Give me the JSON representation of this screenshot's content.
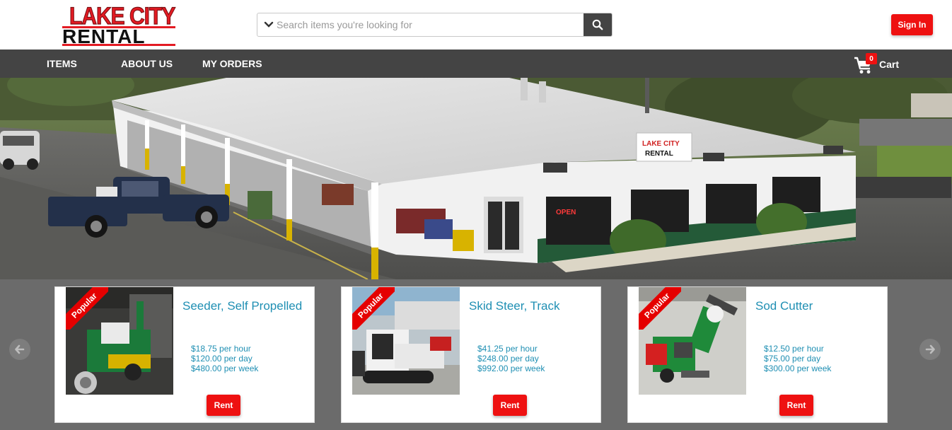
{
  "header": {
    "logo_line1": "LAKE CITY",
    "logo_line2": "RENTAL",
    "search_placeholder": "Search items you're looking for",
    "search_value": "",
    "signin_label": "Sign In"
  },
  "nav": {
    "items": [
      {
        "label": "ITEMS"
      },
      {
        "label": "ABOUT US"
      },
      {
        "label": "MY ORDERS"
      }
    ],
    "cart": {
      "label": "Cart",
      "count": "0"
    }
  },
  "hero": {
    "sign_line1": "LAKE CITY",
    "sign_line2": "RENTAL",
    "open_sign": "OPEN"
  },
  "products": [
    {
      "badge": "Popular",
      "name": "Seeder, Self Propelled",
      "hour": "$18.75 per hour",
      "day": "$120.00 per day",
      "week": "$480.00 per week",
      "rent_label": "Rent"
    },
    {
      "badge": "Popular",
      "name": "Skid Steer, Track",
      "hour": "$41.25 per hour",
      "day": "$248.00 per day",
      "week": "$992.00 per week",
      "rent_label": "Rent"
    },
    {
      "badge": "Popular",
      "name": "Sod Cutter",
      "hour": "$12.50 per hour",
      "day": "$75.00 per day",
      "week": "$300.00 per week",
      "rent_label": "Rent"
    }
  ],
  "colors": {
    "accent_red": "#ee1111",
    "nav_bg": "#444444",
    "carousel_bg": "#6b6b6b",
    "link_blue": "#1f8fb3"
  },
  "icons": {
    "search": "search-icon",
    "dropdown": "chevron-down-icon",
    "cart": "cart-icon",
    "prev": "arrow-left-icon",
    "next": "arrow-right-icon"
  }
}
